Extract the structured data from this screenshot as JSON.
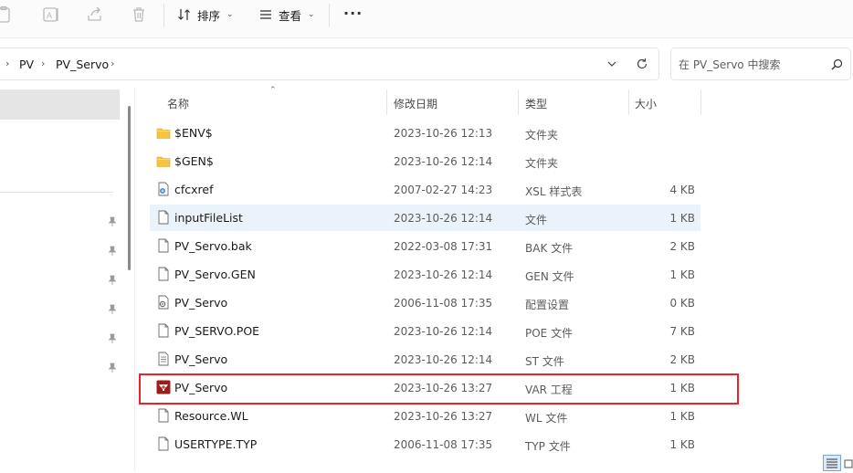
{
  "toolbar": {
    "sort_label": "排序",
    "view_label": "查看",
    "more_label": "···"
  },
  "address": {
    "crumbs": [
      "PV",
      "PV_Servo"
    ]
  },
  "search": {
    "placeholder": "在 PV_Servo 中搜索"
  },
  "columns": {
    "name": "名称",
    "date": "修改日期",
    "type": "类型",
    "size": "大小"
  },
  "files": [
    {
      "name": "$ENV$",
      "date": "2023-10-26 12:13",
      "type": "文件夹",
      "size": "",
      "icon": "folder-icon"
    },
    {
      "name": "$GEN$",
      "date": "2023-10-26 12:14",
      "type": "文件夹",
      "size": "",
      "icon": "folder-icon"
    },
    {
      "name": "cfcxref",
      "date": "2007-02-27 14:23",
      "type": "XSL 样式表",
      "size": "4 KB",
      "icon": "xsl-file-icon"
    },
    {
      "name": "inputFileList",
      "date": "2023-10-26 12:14",
      "type": "文件",
      "size": "1 KB",
      "icon": "file-icon"
    },
    {
      "name": "PV_Servo.bak",
      "date": "2022-03-08 17:31",
      "type": "BAK 文件",
      "size": "2 KB",
      "icon": "file-icon"
    },
    {
      "name": "PV_Servo.GEN",
      "date": "2023-10-26 12:14",
      "type": "GEN 文件",
      "size": "1 KB",
      "icon": "file-icon"
    },
    {
      "name": "PV_Servo",
      "date": "2006-11-08 17:35",
      "type": "配置设置",
      "size": "0 KB",
      "icon": "config-file-icon"
    },
    {
      "name": "PV_SERVO.POE",
      "date": "2023-10-26 12:14",
      "type": "POE 文件",
      "size": "7 KB",
      "icon": "file-icon"
    },
    {
      "name": "PV_Servo",
      "date": "2023-10-26 12:14",
      "type": "ST 文件",
      "size": "2 KB",
      "icon": "text-file-icon"
    },
    {
      "name": "PV_Servo",
      "date": "2023-10-26 13:27",
      "type": "VAR 工程",
      "size": "1 KB",
      "icon": "var-project-icon"
    },
    {
      "name": "Resource.WL",
      "date": "2023-10-26 13:27",
      "type": "WL 文件",
      "size": "1 KB",
      "icon": "file-icon"
    },
    {
      "name": "USERTYPE.TYP",
      "date": "2006-11-08 17:35",
      "type": "TYP 文件",
      "size": "1 KB",
      "icon": "file-icon"
    }
  ],
  "colors": {
    "highlight_border": "#e8232b",
    "selected_row": "#eaf3fb",
    "folder": "#f5c242"
  }
}
